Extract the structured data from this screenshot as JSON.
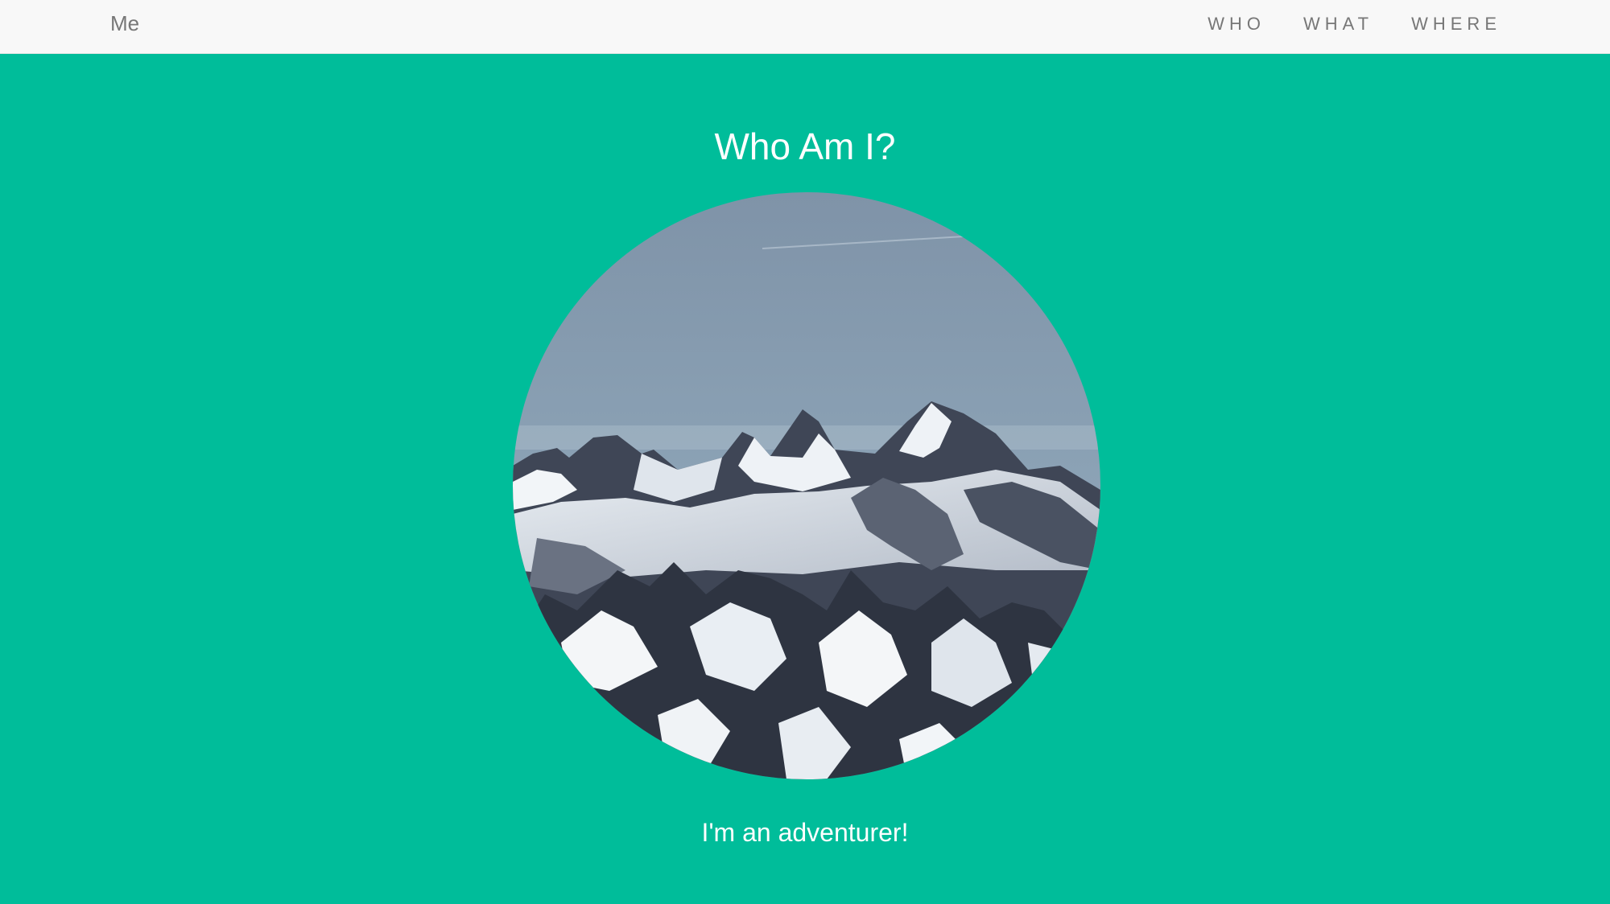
{
  "navbar": {
    "brand": "Me",
    "links": [
      {
        "label": "WHO"
      },
      {
        "label": "WHAT"
      },
      {
        "label": "WHERE"
      }
    ]
  },
  "hero": {
    "title": "Who Am I?",
    "image_icon": "mountain-photo",
    "tagline": "I'm an adventurer!"
  },
  "colors": {
    "background": "#00bd9a",
    "navbar": "#f8f8f8",
    "nav_text": "#777777",
    "hero_text": "#ffffff"
  }
}
